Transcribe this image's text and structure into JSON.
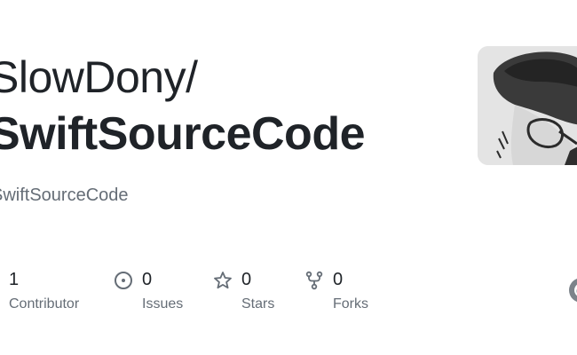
{
  "repo_card": {
    "owner": "SlowDony/",
    "name": "SwiftSourceCode",
    "description": "SwiftSourceCode"
  },
  "stats": {
    "contributors": {
      "count": "1",
      "label": "Contributor"
    },
    "issues": {
      "count": "0",
      "label": "Issues",
      "icon": "issue-opened-icon"
    },
    "stars": {
      "count": "0",
      "label": "Stars",
      "icon": "star-icon"
    },
    "forks": {
      "count": "0",
      "label": "Forks",
      "icon": "repo-forked-icon"
    }
  },
  "colors": {
    "text_primary": "#1f2328",
    "text_secondary": "#656d76",
    "background": "#ffffff"
  }
}
